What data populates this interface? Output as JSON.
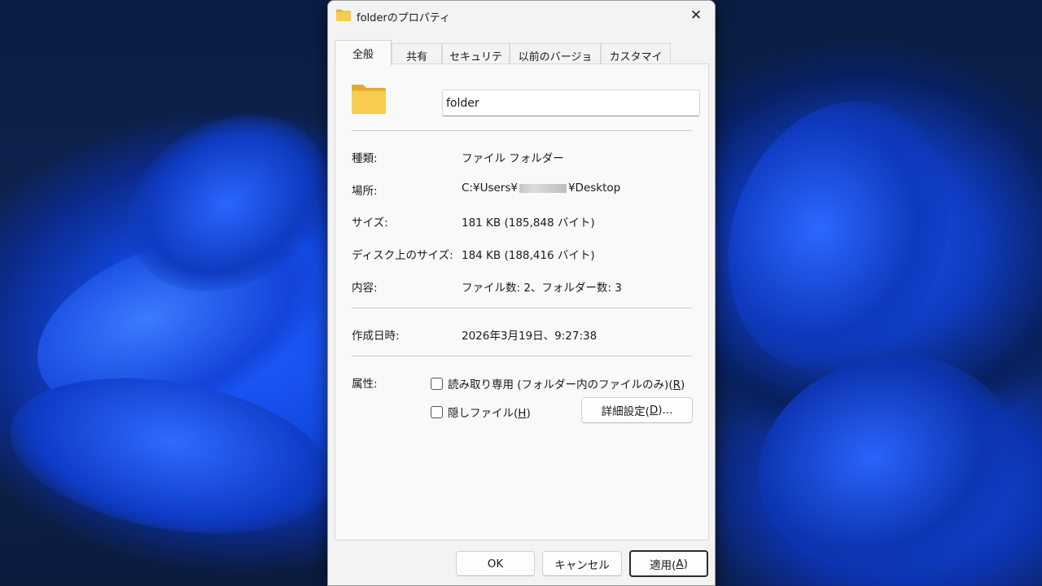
{
  "window": {
    "title": "folderのプロパティ",
    "close_glyph": "✕"
  },
  "tabs": [
    {
      "label": "全般",
      "active": true
    },
    {
      "label": "共有",
      "active": false
    },
    {
      "label": "セキュリティ",
      "active": false
    },
    {
      "label": "以前のバージョン",
      "active": false
    },
    {
      "label": "カスタマイズ",
      "active": false
    }
  ],
  "general": {
    "folder_name": "folder",
    "type_label": "種類:",
    "type_value": "ファイル フォルダー",
    "location_label": "場所:",
    "location_prefix": "C:¥Users¥",
    "location_suffix": "¥Desktop",
    "size_label": "サイズ:",
    "size_value": "181 KB (185,848 バイト)",
    "disk_size_label": "ディスク上のサイズ:",
    "disk_size_value": "184 KB (188,416 バイト)",
    "contents_label": "内容:",
    "contents_value": "ファイル数: 2、フォルダー数: 3",
    "created_label": "作成日時:",
    "created_value": "2026年3月19日、9:27:38",
    "attributes_label": "属性:",
    "readonly_text": "読み取り専用 (フォルダー内のファイルのみ)(",
    "readonly_key": "R",
    "readonly_close": ")",
    "readonly_checked": false,
    "hidden_text": "隠しファイル(",
    "hidden_key": "H",
    "hidden_close": ")",
    "hidden_checked": false,
    "advanced_text": "詳細設定(",
    "advanced_key": "D",
    "advanced_close": ")..."
  },
  "footer": {
    "ok_label": "OK",
    "cancel_label": "キャンセル",
    "apply_text": "適用(",
    "apply_key": "A",
    "apply_close": ")"
  },
  "colors": {
    "folder_yellow": "#f5c842",
    "folder_yellow_dark": "#e3a92a",
    "wallpaper_blue": "#1f5cff"
  },
  "icons": {
    "title_icon": "folder-icon",
    "big_icon": "folder-icon",
    "close_icon": "close-icon"
  }
}
